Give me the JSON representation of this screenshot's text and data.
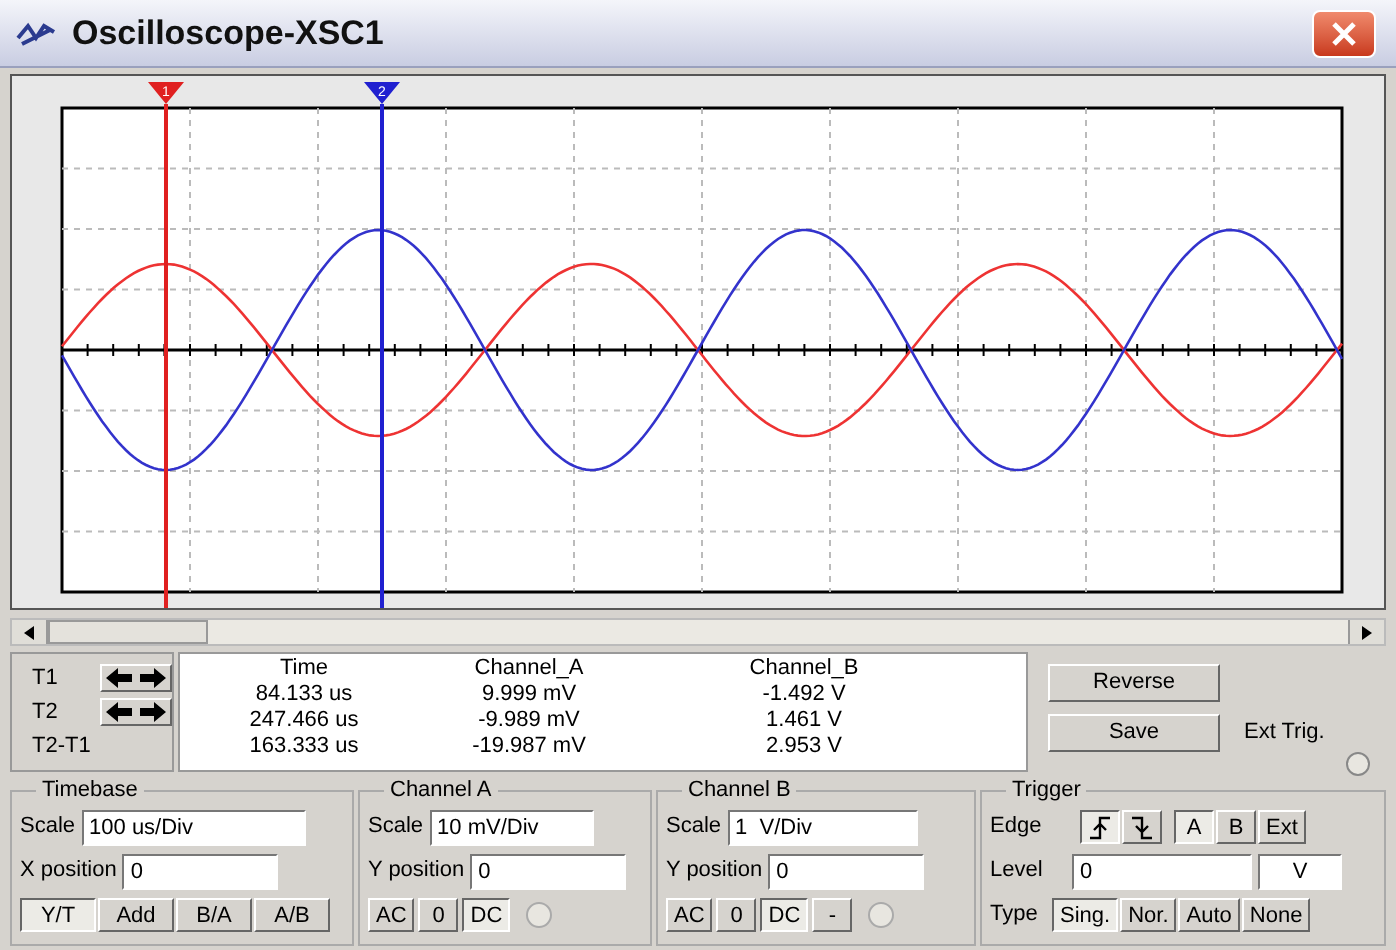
{
  "window": {
    "title": "Oscilloscope-XSC1"
  },
  "cursors": [
    {
      "label": "1",
      "color": "#e02020"
    },
    {
      "label": "2",
      "color": "#2020d0"
    }
  ],
  "readout": {
    "columns": [
      "Time",
      "Channel_A",
      "Channel_B"
    ],
    "rows": [
      {
        "label": "T1",
        "kind": "cursor",
        "values": [
          "84.133 us",
          "9.999 mV",
          "-1.492 V"
        ]
      },
      {
        "label": "T2",
        "kind": "cursor",
        "values": [
          "247.466 us",
          "-9.989 mV",
          "1.461 V"
        ]
      },
      {
        "label": "T2-T1",
        "kind": "difference",
        "values": [
          "163.333 us",
          "-19.987 mV",
          "2.953 V"
        ]
      }
    ]
  },
  "reverse_button": "Reverse",
  "save_button": "Save",
  "ext_trigger": {
    "label": "Ext Trig."
  },
  "timebase": {
    "title": "Timebase",
    "scale": {
      "label": "Scale",
      "value": "100 us/Div"
    },
    "position": {
      "label": "X position",
      "value": "0"
    },
    "modes": [
      {
        "label": "Y/T",
        "selected": true
      },
      {
        "label": "Add",
        "selected": false
      },
      {
        "label": "B/A",
        "selected": false
      },
      {
        "label": "A/B",
        "selected": false
      }
    ]
  },
  "channel_a": {
    "title": "Channel A",
    "scale": {
      "label": "Scale",
      "value": "10 mV/Div"
    },
    "position": {
      "label": "Y position",
      "value": "0"
    },
    "coupling": [
      {
        "label": "AC",
        "selected": false
      },
      {
        "label": "0",
        "selected": false
      },
      {
        "label": "DC",
        "selected": true
      }
    ]
  },
  "channel_b": {
    "title": "Channel B",
    "scale": {
      "label": "Scale",
      "value": "1  V/Div"
    },
    "position": {
      "label": "Y position",
      "value": "0"
    },
    "coupling": [
      {
        "label": "AC",
        "selected": false
      },
      {
        "label": "0",
        "selected": false
      },
      {
        "label": "DC",
        "selected": true
      },
      {
        "label": "-",
        "selected": false
      }
    ]
  },
  "trigger": {
    "title": "Trigger",
    "edge_label": "Edge",
    "edges": [
      {
        "kind": "rising",
        "selected": true
      },
      {
        "kind": "falling",
        "selected": false
      }
    ],
    "sources": [
      {
        "label": "A",
        "selected": true
      },
      {
        "label": "B",
        "selected": false
      },
      {
        "label": "Ext",
        "selected": false
      }
    ],
    "level": {
      "label": "Level",
      "value": "0",
      "unit": "V"
    },
    "type_label": "Type",
    "types": [
      {
        "label": "Sing.",
        "selected": true
      },
      {
        "label": "Nor.",
        "selected": false
      },
      {
        "label": "Auto",
        "selected": false
      },
      {
        "label": "None",
        "selected": false
      }
    ]
  }
}
